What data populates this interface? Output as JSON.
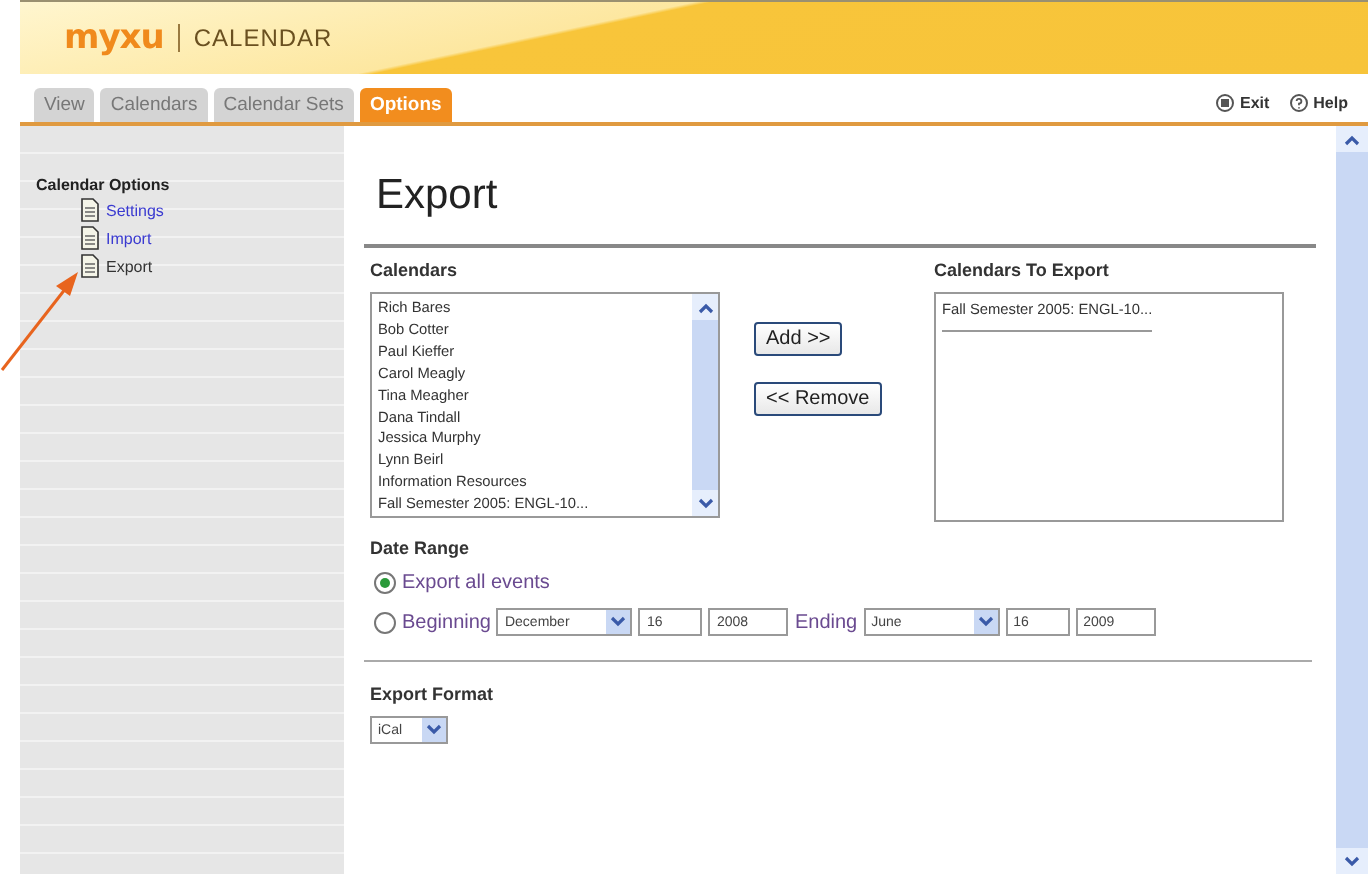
{
  "header": {
    "logo": "myxu",
    "title": "CALENDAR"
  },
  "tabs": [
    {
      "label": "View",
      "selected": false
    },
    {
      "label": "Calendars",
      "selected": false
    },
    {
      "label": "Calendar Sets",
      "selected": false
    },
    {
      "label": "Options",
      "selected": true
    }
  ],
  "top_links": [
    {
      "kind": "exit",
      "label": "Exit"
    },
    {
      "kind": "help",
      "label": "Help"
    }
  ],
  "sidebar": {
    "heading": "Calendar Options",
    "items": [
      {
        "label": "Settings",
        "selected": false
      },
      {
        "label": "Import",
        "selected": false
      },
      {
        "label": "Export",
        "selected": true
      }
    ]
  },
  "page_title": "Export",
  "calendars": {
    "label": "Calendars",
    "items": [
      "Rich Bares",
      "Bob Cotter",
      "Paul Kieffer",
      "Carol Meagly",
      "Tina Meagher",
      "Dana Tindall",
      "Jessica Murphy",
      "Lynn Beirl",
      "Information Resources",
      "Fall Semester 2005: ENGL-10..."
    ]
  },
  "buttons": [
    "Add >>",
    "<< Remove"
  ],
  "export_list": {
    "label": "Calendars To Export",
    "items": [
      "Fall Semester 2005: ENGL-10..."
    ]
  },
  "date_range": {
    "label": "Date Range",
    "options": [
      {
        "kind": "all",
        "label": "Export all events",
        "selected": true
      },
      {
        "kind": "range",
        "label": "Beginning",
        "selected": false,
        "start": {
          "month": "December",
          "day": "16",
          "year": "2008"
        },
        "end_label": "Ending",
        "end": {
          "month": "June",
          "day": "16",
          "year": "2009"
        }
      }
    ]
  },
  "export_format": {
    "label": "Export Format",
    "value": "iCal"
  }
}
